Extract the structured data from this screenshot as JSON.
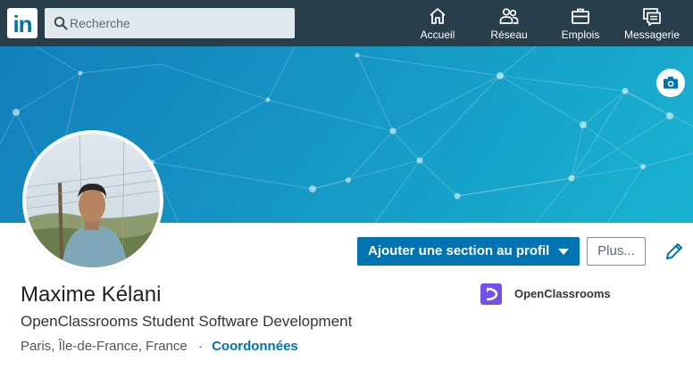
{
  "header": {
    "logo_text": "in",
    "search": {
      "placeholder": "Recherche"
    },
    "nav": [
      {
        "label": "Accueil",
        "icon": "home-icon"
      },
      {
        "label": "Réseau",
        "icon": "network-icon"
      },
      {
        "label": "Emplois",
        "icon": "briefcase-icon"
      },
      {
        "label": "Messagerie",
        "icon": "messaging-icon"
      }
    ]
  },
  "profile": {
    "name": "Maxime Kélani",
    "headline": "OpenClassrooms Student Software Development",
    "location": "Paris, Île-de-France, France",
    "separator": "·",
    "contact_link": "Coordonnées",
    "company": {
      "name": "OpenClassrooms",
      "icon": "openclassrooms-logo"
    }
  },
  "actions": {
    "add_section": "Ajouter une section au profil",
    "more": "Plus...",
    "edit_icon": "pencil-icon",
    "cover_camera_icon": "camera-icon"
  },
  "colors": {
    "nav_background": "#283e4a",
    "accent": "#0073b1",
    "company_logo": "#7451eb"
  }
}
